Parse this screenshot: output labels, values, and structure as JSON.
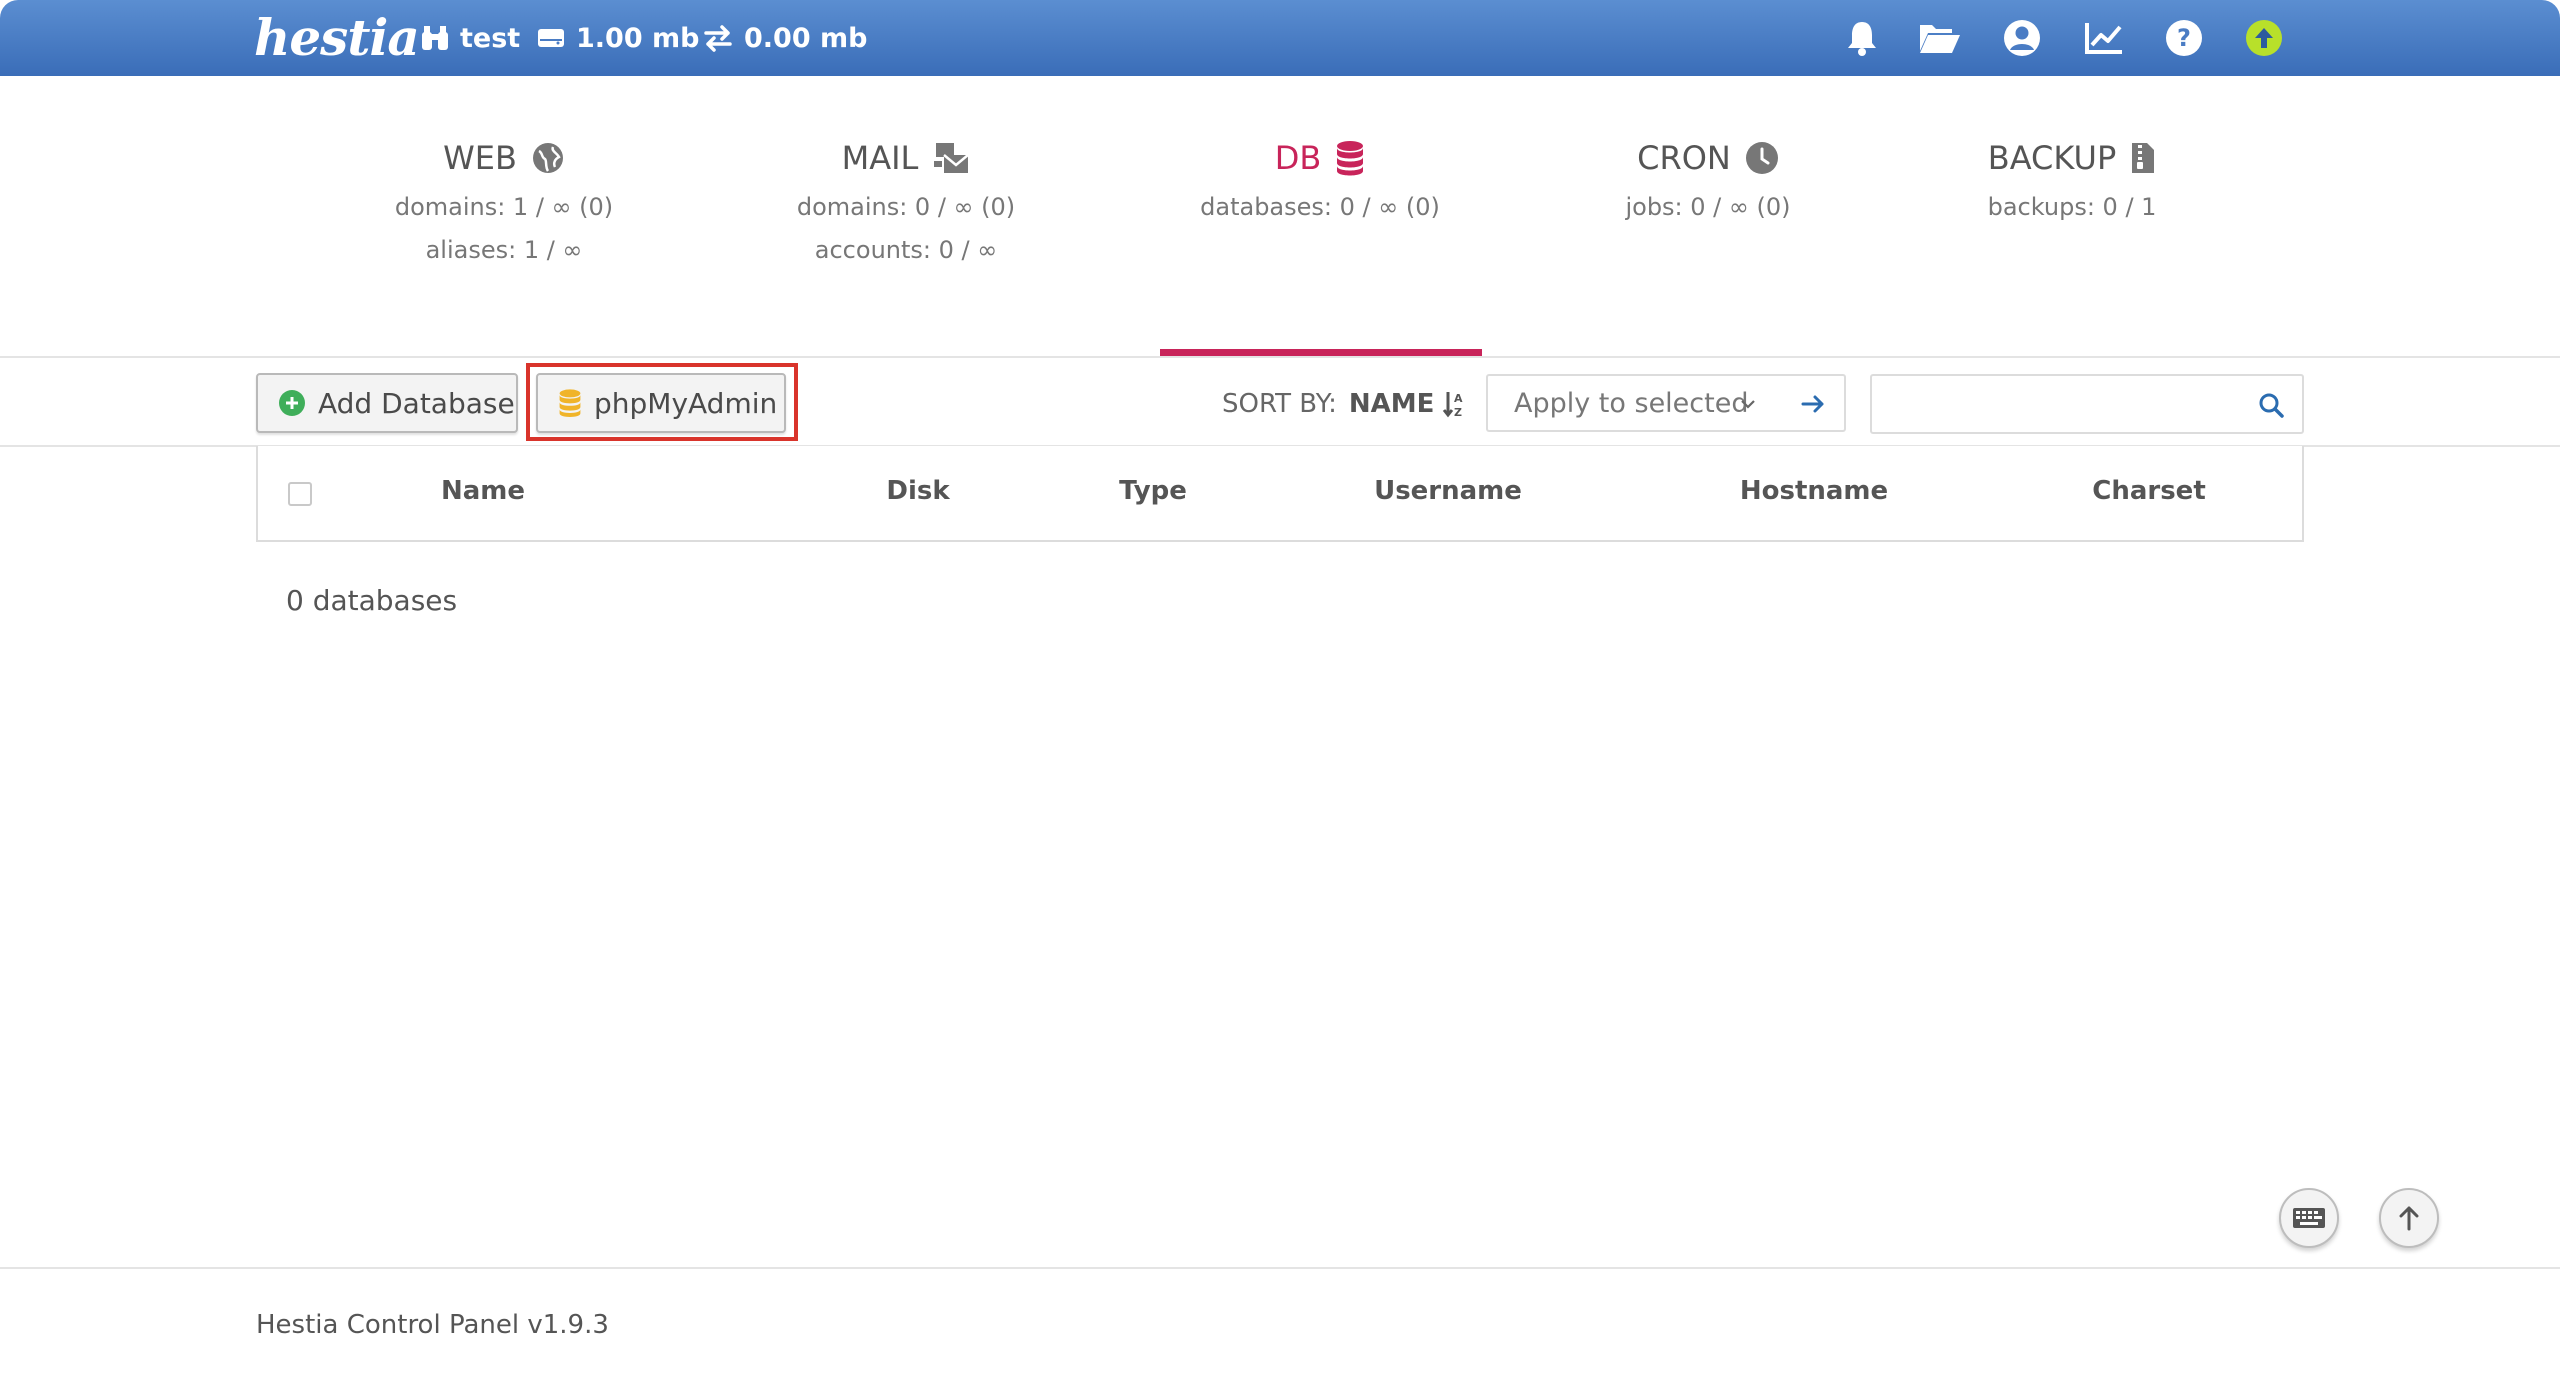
{
  "header": {
    "logo": "hestia",
    "user": "test",
    "disk": "1.00 mb",
    "bandwidth": "0.00 mb",
    "icons": [
      "bell-icon",
      "folder-open-icon",
      "user-circle-icon",
      "chart-line-icon",
      "question-icon",
      "upload-icon"
    ]
  },
  "tabs": [
    {
      "title": "WEB",
      "icon": "globe-icon",
      "lines": [
        "domains: 1 / ∞ (0)",
        "aliases: 1 / ∞"
      ]
    },
    {
      "title": "MAIL",
      "icon": "mail-bulk-icon",
      "lines": [
        "domains: 0 / ∞ (0)",
        "accounts: 0 / ∞"
      ]
    },
    {
      "title": "DB",
      "icon": "database-icon",
      "lines": [
        "databases: 0 / ∞ (0)"
      ]
    },
    {
      "title": "CRON",
      "icon": "clock-icon",
      "lines": [
        "jobs: 0 / ∞ (0)"
      ]
    },
    {
      "title": "BACKUP",
      "icon": "file-archive-icon",
      "lines": [
        "backups: 0 / 1"
      ]
    }
  ],
  "toolbar": {
    "add_label": "Add Database",
    "pma_label": "phpMyAdmin",
    "sort_label": "SORT BY:",
    "sort_value": "NAME",
    "apply_label": "Apply to selected",
    "search_placeholder": ""
  },
  "table": {
    "headers": [
      "Name",
      "Disk",
      "Type",
      "Username",
      "Hostname",
      "Charset"
    ],
    "count_text": "0 databases"
  },
  "footer": {
    "text": "Hestia Control Panel v1.9.3"
  },
  "colors": {
    "accent": "#c8245a",
    "header": "#4a7cc4",
    "highlight": "#d9342b",
    "add_icon": "#3fae5a",
    "pma_icon": "#f0b429",
    "upload_icon": "#b8e02a"
  }
}
